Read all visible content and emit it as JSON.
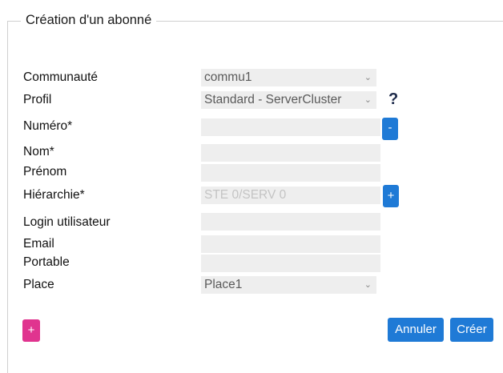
{
  "form": {
    "title": "Création d'un abonné",
    "rows": {
      "communaute": {
        "label": "Communauté",
        "value": "commu1"
      },
      "profil": {
        "label": "Profil",
        "value": "Standard - ServerCluster",
        "help": "?"
      },
      "numero": {
        "label": "Numéro*",
        "value": "",
        "button": "-"
      },
      "nom": {
        "label": "Nom*",
        "value": ""
      },
      "prenom": {
        "label": "Prénom",
        "value": ""
      },
      "hierarchie": {
        "label": "Hiérarchie*",
        "placeholder": "STE 0/SERV 0",
        "button": "+"
      },
      "login": {
        "label": "Login utilisateur",
        "value": ""
      },
      "email": {
        "label": "Email",
        "value": ""
      },
      "portable": {
        "label": "Portable",
        "value": ""
      },
      "place": {
        "label": "Place",
        "value": "Place1"
      }
    },
    "actions": {
      "add": "+",
      "cancel": "Annuler",
      "create": "Créer"
    }
  },
  "colors": {
    "primary": "#1f7ad6",
    "pink": "#e0348f",
    "field_bg": "#eeeeee"
  }
}
